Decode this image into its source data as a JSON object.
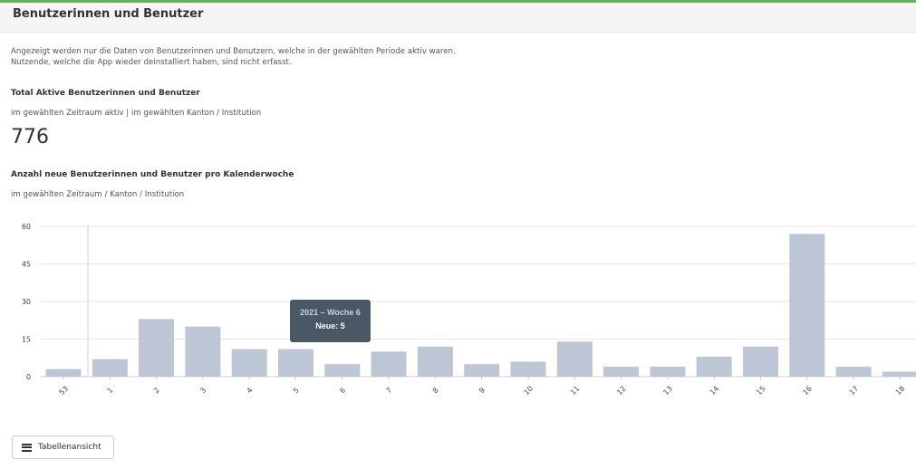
{
  "panel": {
    "title": "Benutzerinnen und Benutzer"
  },
  "intro": {
    "line1": "Angezeigt werden nur die Daten von Benutzerinnen und Benutzern, welche in der gewählten Periode aktiv waren.",
    "line2": "Nutzende, welche die App wieder deinstalliert haben, sind nicht erfasst."
  },
  "total": {
    "title": "Total Aktive Benutzerinnen und Benutzer",
    "subtitle": "im gewählten Zeitraum aktiv | im gewählten Kanton / Institution",
    "value": "776"
  },
  "chart_section": {
    "title": "Anzahl neue Benutzerinnen und Benutzer pro Kalenderwoche",
    "subtitle": "im gewählten Zeitraum / Kanton / Institution"
  },
  "tooltip": {
    "title": "2021 – Woche 6",
    "value": "Neue: 5"
  },
  "table_button": {
    "label": "Tabellenansicht",
    "icon": "list-icon"
  },
  "colors": {
    "accent": "#5cb85c",
    "bar": "#bcc6d4",
    "tooltip_bg": "#4a5866"
  },
  "chart_data": {
    "type": "bar",
    "categories": [
      "53",
      "1",
      "2",
      "3",
      "4",
      "5",
      "6",
      "7",
      "8",
      "9",
      "10",
      "11",
      "12",
      "13",
      "14",
      "15",
      "16",
      "17",
      "18"
    ],
    "values": [
      3,
      7,
      23,
      20,
      11,
      11,
      5,
      10,
      12,
      5,
      6,
      14,
      4,
      4,
      8,
      12,
      57,
      4,
      2
    ],
    "yticks": [
      0,
      15,
      30,
      45,
      60
    ],
    "ylim": [
      0,
      60
    ],
    "grid": true,
    "legend": "none"
  }
}
